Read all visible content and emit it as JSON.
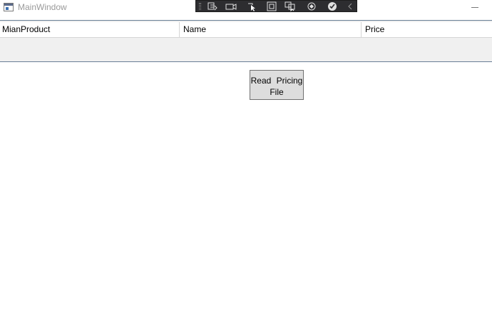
{
  "window": {
    "title": "MainWindow",
    "minimize_symbol": ""
  },
  "debug_toolbar": {
    "icons": [
      "go-to-live-visual-tree-icon",
      "video-camera-icon",
      "select-element-icon",
      "display-layout-adorners-icon",
      "track-focus-icon",
      "hot-reload-icon",
      "binding-check-icon",
      "collapse-chevron-icon"
    ]
  },
  "grid": {
    "columns": [
      "MianProduct",
      "Name",
      "Price"
    ]
  },
  "read_button": {
    "label": "Read  Pricing File"
  },
  "colors": {
    "grid_background": "#f0f0f0",
    "separator": "#6a7f96",
    "toolbar_background": "#2d2d30",
    "button_background": "#dddddd"
  }
}
